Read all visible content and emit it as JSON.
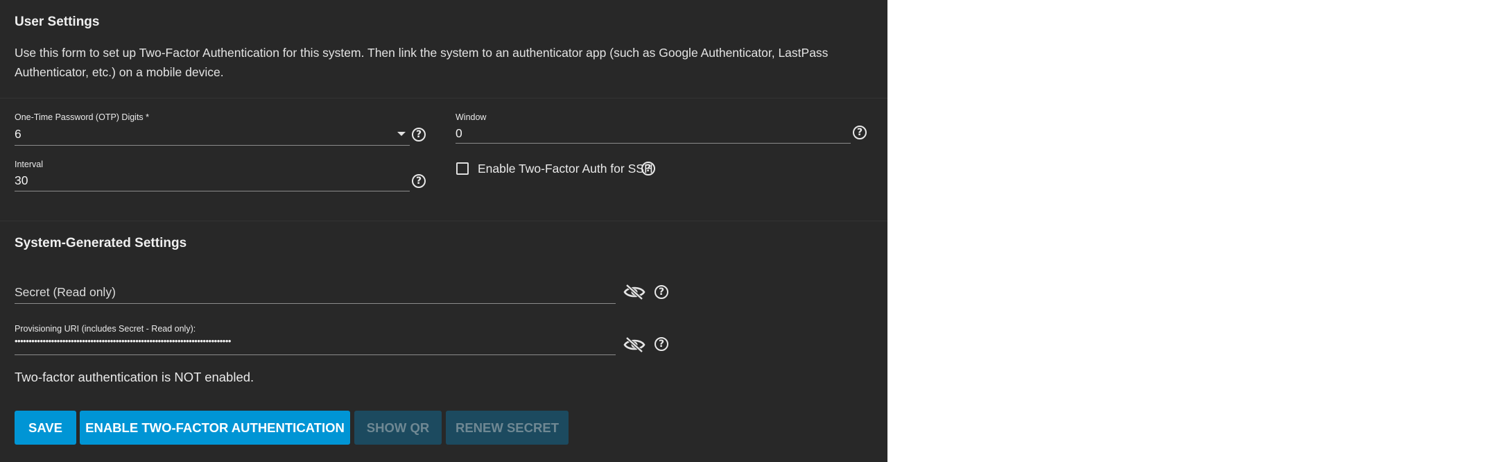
{
  "user_settings": {
    "title": "User Settings",
    "description": "Use this form to set up Two-Factor Authentication for this system. Then link the system to an authenticator app (such as Google Authenticator, LastPass Authenticator, etc.) on a mobile device.",
    "otp_digits": {
      "label": "One-Time Password (OTP) Digits *",
      "value": "6"
    },
    "window": {
      "label": "Window",
      "value": "0"
    },
    "interval": {
      "label": "Interval",
      "value": "30"
    },
    "ssh_checkbox": {
      "label": "Enable Two-Factor Auth for SSH",
      "checked": false
    }
  },
  "system_settings": {
    "title": "System-Generated Settings",
    "secret": {
      "placeholder": "Secret (Read only)",
      "value": ""
    },
    "provisioning_uri": {
      "label": "Provisioning URI (includes Secret - Read only):",
      "value": "•••••••••••••••••••••••••••••••••••••••••••••••••••••••••••••••••••••••••••••"
    }
  },
  "status_text": "Two-factor authentication is NOT enabled.",
  "buttons": {
    "save": "SAVE",
    "enable": "ENABLE TWO-FACTOR AUTHENTICATION",
    "show_qr": "SHOW QR",
    "renew_secret": "RENEW SECRET"
  },
  "icons": {
    "help": "help-circle-icon",
    "visibility_off": "eye-off-icon",
    "dropdown": "caret-down-icon"
  },
  "colors": {
    "panel_bg": "#282828",
    "primary": "#0095d5",
    "disabled_bg": "#1c4a5f",
    "disabled_text": "#6f8893"
  }
}
